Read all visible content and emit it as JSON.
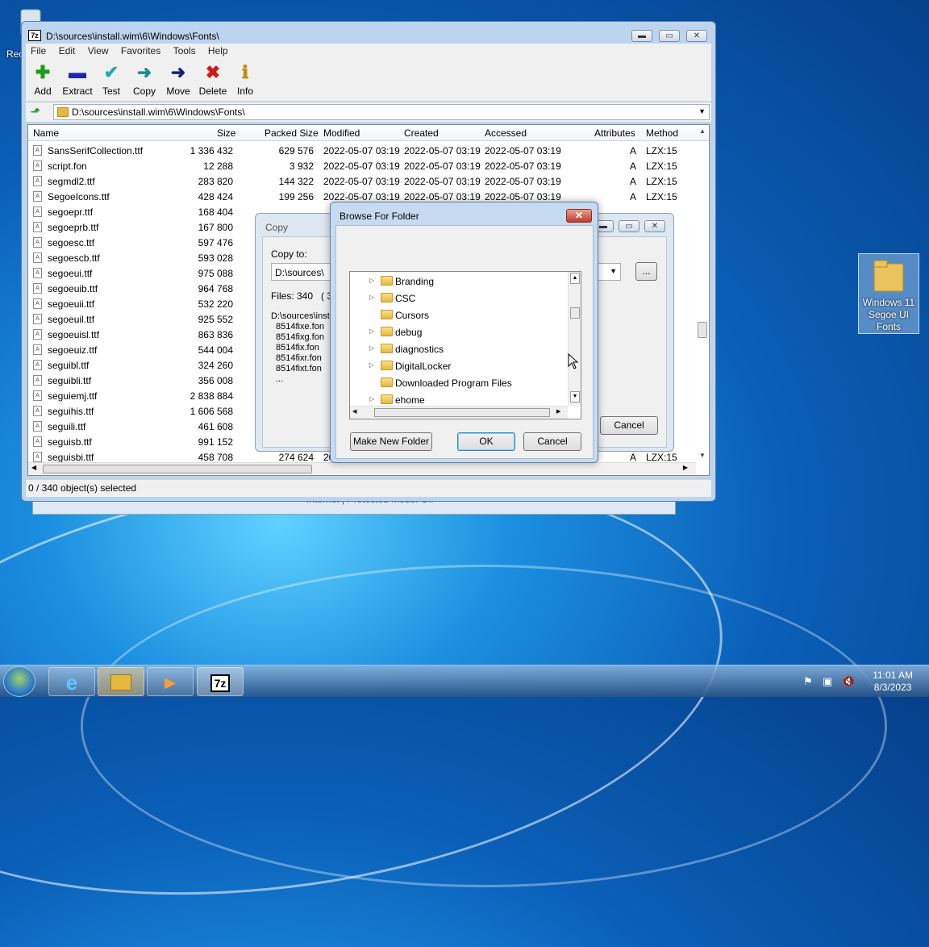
{
  "desktop": {
    "recycle_label": "Rec",
    "folder_icon_label": "Windows 11 Segoe UI Fonts"
  },
  "background_window": {
    "status_text": "Internet | Protected Mode: Off"
  },
  "main_window": {
    "title": "D:\\sources\\install.wim\\6\\Windows\\Fonts\\",
    "app_icon_text": "7z",
    "menu": [
      "File",
      "Edit",
      "View",
      "Favorites",
      "Tools",
      "Help"
    ],
    "toolbar": [
      {
        "label": "Add",
        "icon": "add-icon"
      },
      {
        "label": "Extract",
        "icon": "extract-icon"
      },
      {
        "label": "Test",
        "icon": "test-icon"
      },
      {
        "label": "Copy",
        "icon": "copy-icon"
      },
      {
        "label": "Move",
        "icon": "move-icon"
      },
      {
        "label": "Delete",
        "icon": "delete-icon"
      },
      {
        "label": "Info",
        "icon": "info-icon"
      }
    ],
    "address": "D:\\sources\\install.wim\\6\\Windows\\Fonts\\",
    "columns": [
      "Name",
      "Size",
      "Packed Size",
      "Modified",
      "Created",
      "Accessed",
      "Attributes",
      "Method"
    ],
    "rows": [
      {
        "name": "SansSerifCollection.ttf",
        "size": "1 336 432",
        "packed": "629 576",
        "modified": "2022-05-07 03:19",
        "created": "2022-05-07 03:19",
        "accessed": "2022-05-07 03:19",
        "attr": "A",
        "method": "LZX:15"
      },
      {
        "name": "script.fon",
        "size": "12 288",
        "packed": "3 932",
        "modified": "2022-05-07 03:19",
        "created": "2022-05-07 03:19",
        "accessed": "2022-05-07 03:19",
        "attr": "A",
        "method": "LZX:15"
      },
      {
        "name": "segmdl2.ttf",
        "size": "283 820",
        "packed": "144 322",
        "modified": "2022-05-07 03:19",
        "created": "2022-05-07 03:19",
        "accessed": "2022-05-07 03:19",
        "attr": "A",
        "method": "LZX:15"
      },
      {
        "name": "SegoeIcons.ttf",
        "size": "428 424",
        "packed": "199 256",
        "modified": "2022-05-07 03:19",
        "created": "2022-05-07 03:19",
        "accessed": "2022-05-07 03:19",
        "attr": "A",
        "method": "LZX:15"
      },
      {
        "name": "segoepr.ttf",
        "size": "168 404",
        "packed": "",
        "modified": "",
        "created": "",
        "accessed": "",
        "attr": "",
        "method": ""
      },
      {
        "name": "segoeprb.ttf",
        "size": "167 800",
        "packed": "",
        "modified": "",
        "created": "",
        "accessed": "",
        "attr": "",
        "method": ""
      },
      {
        "name": "segoesc.ttf",
        "size": "597 476",
        "packed": "",
        "modified": "",
        "created": "",
        "accessed": "",
        "attr": "",
        "method": ""
      },
      {
        "name": "segoescb.ttf",
        "size": "593 028",
        "packed": "",
        "modified": "",
        "created": "",
        "accessed": "",
        "attr": "",
        "method": ""
      },
      {
        "name": "segoeui.ttf",
        "size": "975 088",
        "packed": "",
        "modified": "",
        "created": "",
        "accessed": "",
        "attr": "",
        "method": ""
      },
      {
        "name": "segoeuib.ttf",
        "size": "964 768",
        "packed": "",
        "modified": "",
        "created": "",
        "accessed": "",
        "attr": "",
        "method": ""
      },
      {
        "name": "segoeuii.ttf",
        "size": "532 220",
        "packed": "",
        "modified": "",
        "created": "",
        "accessed": "",
        "attr": "",
        "method": ""
      },
      {
        "name": "segoeuil.ttf",
        "size": "925 552",
        "packed": "",
        "modified": "",
        "created": "",
        "accessed": "",
        "attr": "",
        "method": ""
      },
      {
        "name": "segoeuisl.ttf",
        "size": "863 836",
        "packed": "",
        "modified": "",
        "created": "",
        "accessed": "",
        "attr": "",
        "method": ""
      },
      {
        "name": "segoeuiz.ttf",
        "size": "544 004",
        "packed": "",
        "modified": "",
        "created": "",
        "accessed": "",
        "attr": "",
        "method": ""
      },
      {
        "name": "seguibl.ttf",
        "size": "324 260",
        "packed": "",
        "modified": "",
        "created": "",
        "accessed": "",
        "attr": "",
        "method": ""
      },
      {
        "name": "seguibli.ttf",
        "size": "356 008",
        "packed": "",
        "modified": "",
        "created": "",
        "accessed": "",
        "attr": "",
        "method": ""
      },
      {
        "name": "seguiemj.ttf",
        "size": "2 838 884",
        "packed": "",
        "modified": "",
        "created": "",
        "accessed": "",
        "attr": "",
        "method": ""
      },
      {
        "name": "seguihis.ttf",
        "size": "1 606 568",
        "packed": "",
        "modified": "",
        "created": "",
        "accessed": "",
        "attr": "",
        "method": ""
      },
      {
        "name": "seguili.ttf",
        "size": "461 608",
        "packed": "",
        "modified": "",
        "created": "",
        "accessed": "",
        "attr": "",
        "method": ""
      },
      {
        "name": "seguisb.ttf",
        "size": "991 152",
        "packed": "",
        "modified": "",
        "created": "",
        "accessed": "",
        "attr": "",
        "method": ""
      },
      {
        "name": "seguisbi.ttf",
        "size": "458 708",
        "packed": "274 624",
        "modified": "20",
        "created": "",
        "accessed": "",
        "attr": "A",
        "method": "LZX:15"
      }
    ],
    "status": "0 / 340 object(s) selected"
  },
  "copy_dialog": {
    "title": "Copy",
    "copy_to_label": "Copy to:",
    "path_value": "D:\\sources\\",
    "browse_btn": "...",
    "files_text": "Files: 340   ( 36",
    "list_lines": [
      "D:\\sources\\inst",
      "8514fixe.fon",
      "8514fixg.fon",
      "8514fix.fon",
      "8514fixr.fon",
      "8514fixt.fon",
      "..."
    ],
    "cancel": "Cancel"
  },
  "browse_dialog": {
    "title": "Browse For Folder",
    "close_glyph": "x",
    "items": [
      {
        "name": "Branding",
        "expandable": true
      },
      {
        "name": "CSC",
        "expandable": true
      },
      {
        "name": "Cursors",
        "expandable": false
      },
      {
        "name": "debug",
        "expandable": true
      },
      {
        "name": "diagnostics",
        "expandable": true
      },
      {
        "name": "DigitalLocker",
        "expandable": true
      },
      {
        "name": "Downloaded Program Files",
        "expandable": false
      },
      {
        "name": "ehome",
        "expandable": true
      }
    ],
    "make_new_folder": "Make New Folder",
    "ok": "OK",
    "cancel": "Cancel"
  },
  "taskbar": {
    "time": "11:01 AM",
    "date": "8/3/2023",
    "app_7z": "7z"
  }
}
